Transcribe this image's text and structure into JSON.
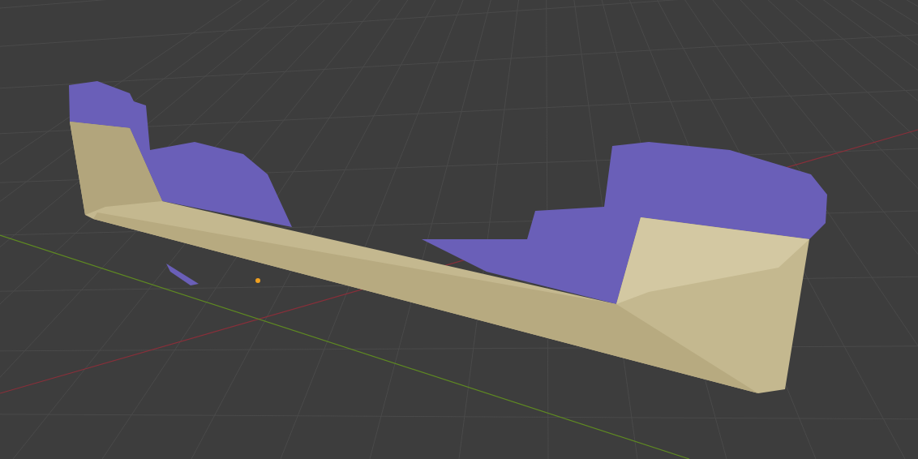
{
  "viewport": {
    "kind": "grid-3d",
    "show_axes": true,
    "show_origin": true
  }
}
